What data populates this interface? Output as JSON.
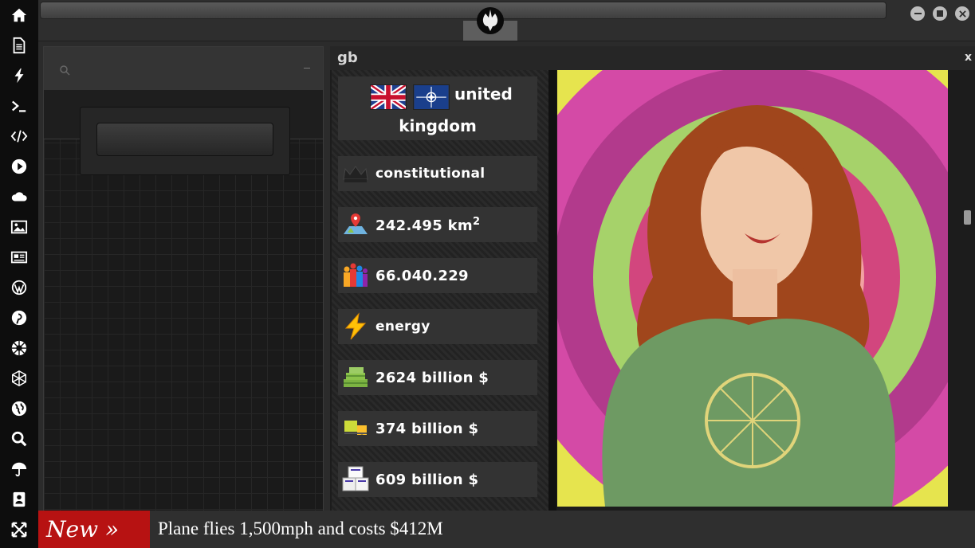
{
  "sidebar": {
    "icons": [
      "home-icon",
      "document-icon",
      "bolt-icon",
      "terminal-icon",
      "code-icon",
      "play-icon",
      "cloud-icon",
      "image-icon",
      "newspaper-icon",
      "wordpress-icon",
      "pinterest-icon",
      "galactic-empire-icon",
      "geodesic-icon",
      "globe-icon",
      "search-icon",
      "umbrella-icon",
      "contacts-icon",
      "expand-icon"
    ]
  },
  "topbar": {
    "logo": "rebel-alliance-icon"
  },
  "panel": {
    "title": "gb",
    "close_label": "x"
  },
  "country": {
    "name_line1": "united",
    "name_line2": "kingdom",
    "flags": [
      "uk-flag-icon",
      "nato-flag-icon"
    ]
  },
  "facts": {
    "government": "constitutional",
    "area_value": "242.495 km",
    "area_sup": "2",
    "population": "66.040.229",
    "category": "energy",
    "gdp": "2624 billion $",
    "exports": "374 billion $",
    "imports": "609 billion $"
  },
  "ticker": {
    "badge": "New »",
    "headline": "Plane flies 1,500mph and costs $412M"
  },
  "colors": {
    "ticker_badge": "#b71212",
    "sidebar_bg": "#0d0d0d"
  }
}
